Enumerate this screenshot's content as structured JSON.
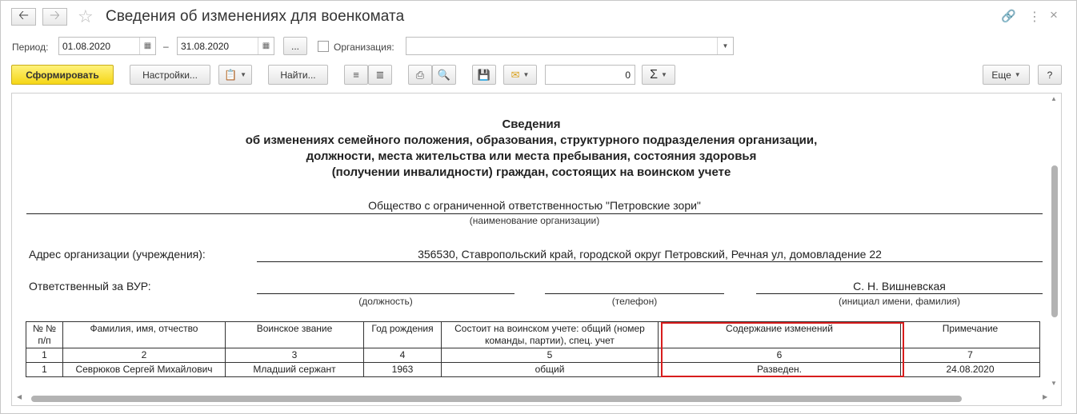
{
  "window": {
    "title": "Сведения об изменениях для военкомата"
  },
  "params": {
    "period_label": "Период:",
    "date_from": "01.08.2020",
    "dash": "–",
    "date_to": "31.08.2020",
    "more_label": "...",
    "org_label": "Организация:",
    "org_value": ""
  },
  "toolbar": {
    "generate": "Сформировать",
    "settings": "Настройки...",
    "find": "Найти...",
    "sum_value": "0",
    "sigma": "Σ",
    "more": "Еще",
    "help": "?"
  },
  "report": {
    "title_lines": [
      "Сведения",
      "об изменениях семейного положения, образования, структурного подразделения организации,",
      "должности, места жительства или места пребывания, состояния здоровья",
      "(получении инвалидности) граждан, состоящих на воинском учете"
    ],
    "org_name": "Общество с ограниченной ответственностью \"Петровские зори\"",
    "org_caption": "(наименование организации)",
    "address_label": "Адрес организации (учреждения):",
    "address_value": "356530, Ставропольский край, городской округ Петровский, Речная ул, домовладение 22",
    "resp_label": "Ответственный за ВУР:",
    "resp_name": "С. Н. Вишневская",
    "cap_position": "(должность)",
    "cap_phone": "(телефон)",
    "cap_name": "(инициал имени, фамилия)",
    "table": {
      "headers": [
        "№ № п/п",
        "Фамилия, имя, отчество",
        "Воинское звание",
        "Год рождения",
        "Состоит на воинском учете: общий (номер команды, партии), спец. учет",
        "Содержание изменений",
        "Примечание"
      ],
      "numbers": [
        "1",
        "2",
        "3",
        "4",
        "5",
        "6",
        "7"
      ],
      "rows": [
        [
          "1",
          "Севрюков Сергей Михайлович",
          "Младший сержант",
          "1963",
          "общий",
          "Разведен.",
          "24.08.2020"
        ]
      ]
    }
  }
}
